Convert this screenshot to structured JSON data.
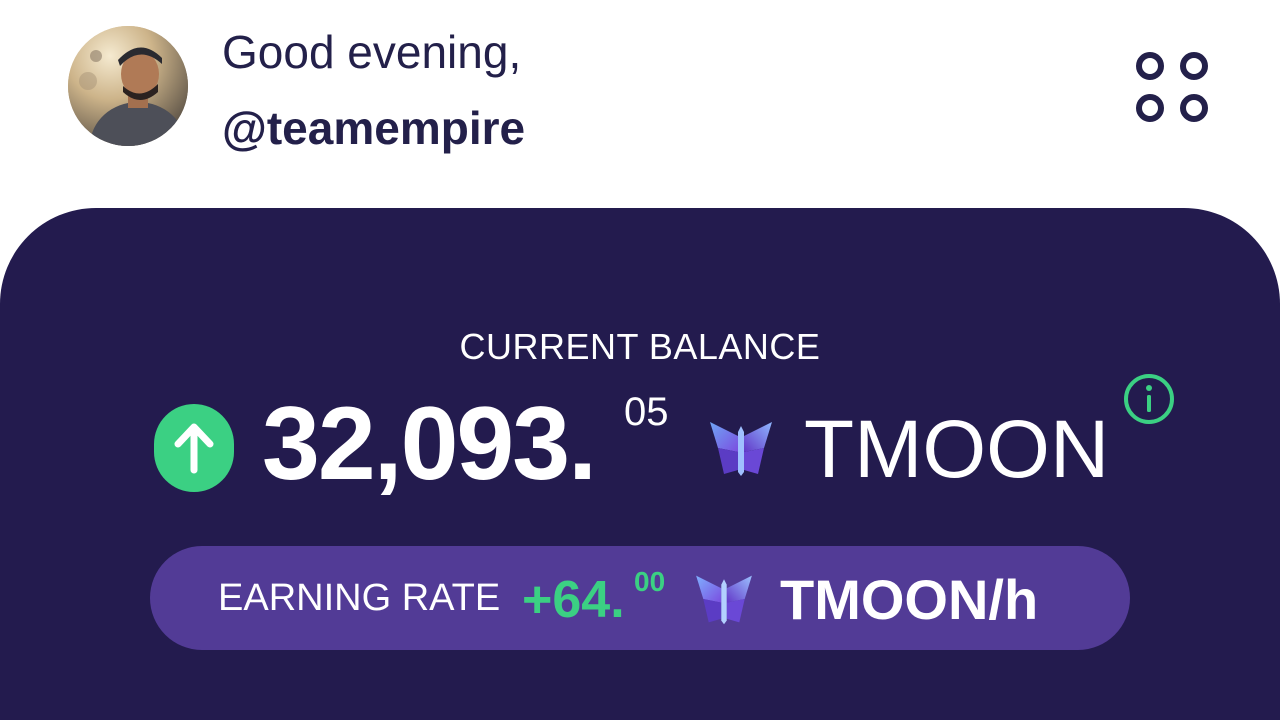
{
  "header": {
    "greeting": "Good evening,",
    "username": "@teamempire",
    "avatar_icon": "user-avatar-photo",
    "menu_icon": "four-circles-menu-icon"
  },
  "balance": {
    "label": "CURRENT BALANCE",
    "integer_part": "32,093.",
    "decimal_part": "05",
    "currency": "TMOON",
    "trend_icon": "arrow-up-icon",
    "token_icon": "butterfly-token-icon",
    "info_icon": "info-icon"
  },
  "earning_rate": {
    "label": "EARNING RATE",
    "integer_part": "+64.",
    "decimal_part": "00",
    "unit": "TMOON/h"
  },
  "colors": {
    "card_background": "#231b4e",
    "pill_background": "#523b96",
    "accent_green": "#3bd083",
    "text_dark": "#23204a"
  }
}
